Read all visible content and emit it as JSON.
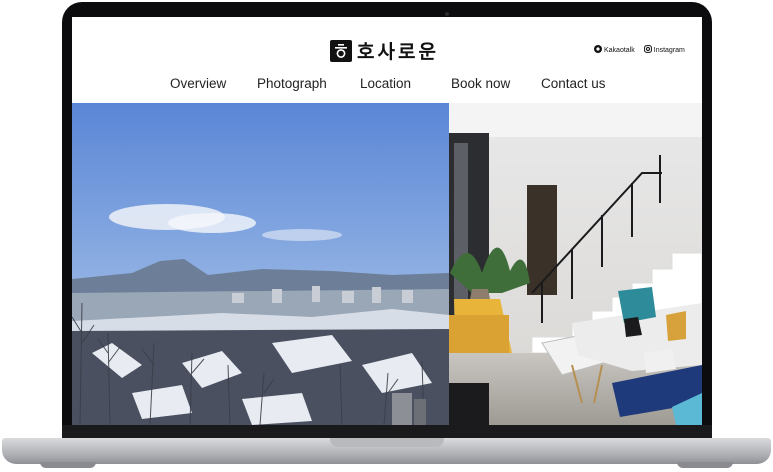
{
  "brand": {
    "name": "호사로운"
  },
  "social": {
    "kakao_label": "Kakaotalk",
    "instagram_label": "Instagram"
  },
  "nav": {
    "items": [
      {
        "label": "Overview"
      },
      {
        "label": "Photograph"
      },
      {
        "label": "Location"
      },
      {
        "label": "Book now"
      },
      {
        "label": "Contact us"
      }
    ]
  },
  "colors": {
    "accent": "#111111",
    "chair": "#e8b43a",
    "sofa_blue": "#1e3a7a",
    "teal": "#2e8c9a"
  },
  "icons": {
    "kakao": "kakaotalk-icon",
    "instagram": "instagram-icon",
    "logo": "hangul-logo-icon"
  }
}
